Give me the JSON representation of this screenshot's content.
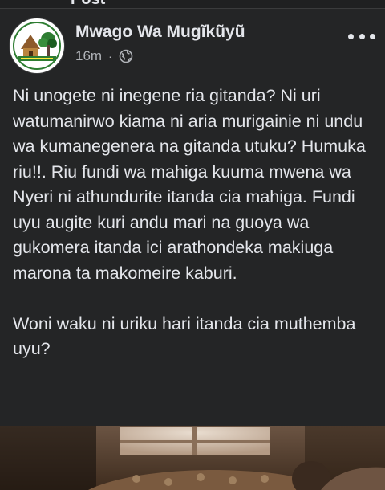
{
  "header": {
    "cut_title": "Post"
  },
  "post": {
    "author": "Mwago Wa Mugĩkũyũ",
    "time": "16m",
    "separator": "·",
    "privacy_icon": "globe-icon",
    "more_icon": "more-options-icon",
    "avatar_icon": "page-logo-icon",
    "body_paragraphs": [
      "Ni unogete ni inegene ria gitanda? Ni uri watumanirwo kiama ni aria murigainie ni undu wa kumanegenera na gitanda utuku? Humuka riu!!. Riu fundi wa mahiga kuuma mwena wa Nyeri ni athundurite itanda cia mahiga. Fundi uyu augite kuri andu mari na guoya wa gukomera itanda ici arathondeka makiuga marona ta makomeire kaburi.",
      "Woni waku ni uriku hari itanda cia muthemba uyu?"
    ]
  },
  "colors": {
    "background": "#242526",
    "text_primary": "#e4e6eb",
    "text_secondary": "#b0b3b8"
  }
}
